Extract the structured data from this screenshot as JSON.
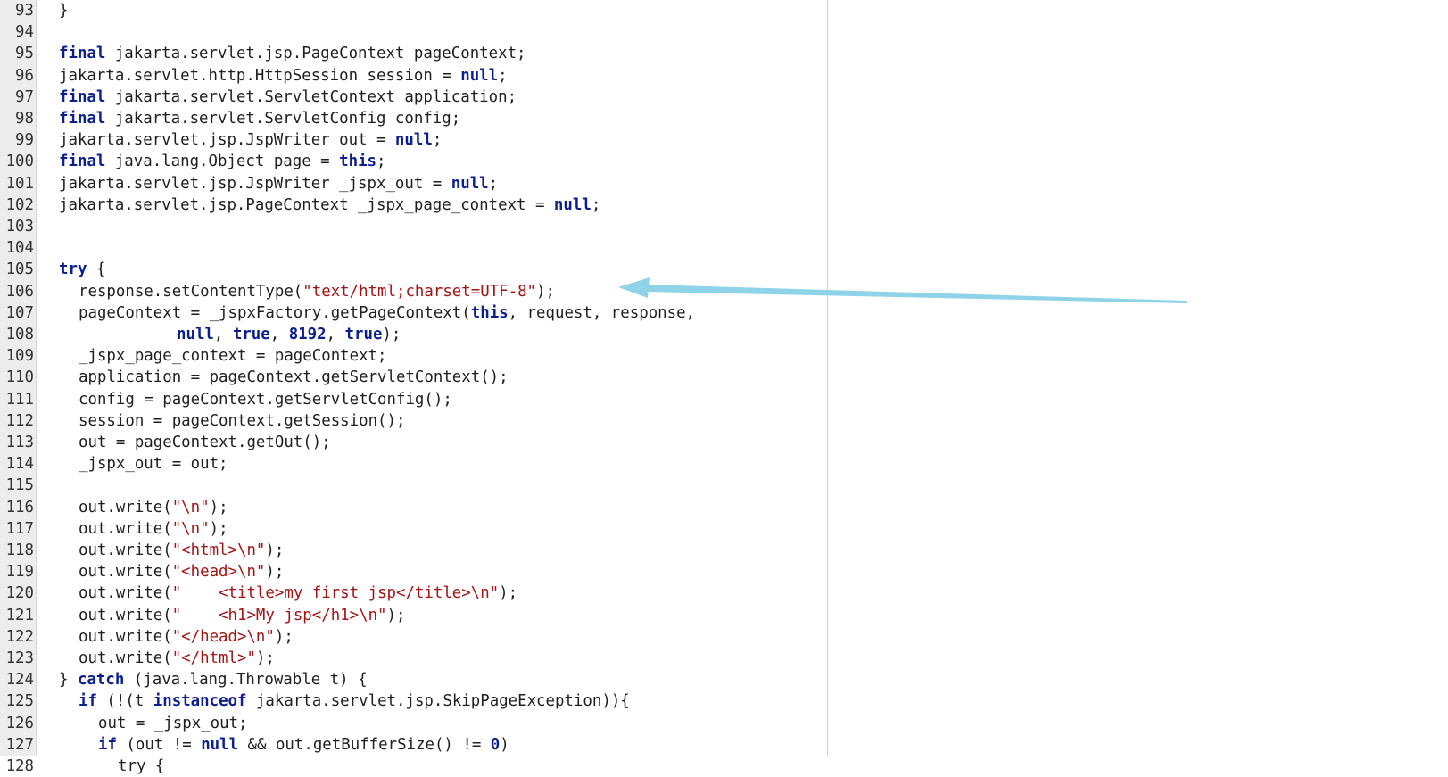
{
  "editor": {
    "lines": [
      {
        "n": "93",
        "indent": 1,
        "tokens": [
          {
            "t": "}",
            "k": "plain"
          }
        ]
      },
      {
        "n": "94",
        "indent": 0,
        "tokens": []
      },
      {
        "n": "95",
        "indent": 1,
        "tokens": [
          {
            "t": "final",
            "k": "kw"
          },
          {
            "t": " jakarta.servlet.jsp.PageContext pageContext;",
            "k": "plain"
          }
        ]
      },
      {
        "n": "96",
        "indent": 1,
        "tokens": [
          {
            "t": "jakarta.servlet.http.HttpSession session = ",
            "k": "plain"
          },
          {
            "t": "null",
            "k": "kw"
          },
          {
            "t": ";",
            "k": "plain"
          }
        ]
      },
      {
        "n": "97",
        "indent": 1,
        "tokens": [
          {
            "t": "final",
            "k": "kw"
          },
          {
            "t": " jakarta.servlet.ServletContext application;",
            "k": "plain"
          }
        ]
      },
      {
        "n": "98",
        "indent": 1,
        "tokens": [
          {
            "t": "final",
            "k": "kw"
          },
          {
            "t": " jakarta.servlet.ServletConfig config;",
            "k": "plain"
          }
        ]
      },
      {
        "n": "99",
        "indent": 1,
        "tokens": [
          {
            "t": "jakarta.servlet.jsp.JspWriter out = ",
            "k": "plain"
          },
          {
            "t": "null",
            "k": "kw"
          },
          {
            "t": ";",
            "k": "plain"
          }
        ]
      },
      {
        "n": "100",
        "indent": 1,
        "tokens": [
          {
            "t": "final",
            "k": "kw"
          },
          {
            "t": " java.lang.Object page = ",
            "k": "plain"
          },
          {
            "t": "this",
            "k": "kw"
          },
          {
            "t": ";",
            "k": "plain"
          }
        ]
      },
      {
        "n": "101",
        "indent": 1,
        "tokens": [
          {
            "t": "jakarta.servlet.jsp.JspWriter _jspx_out = ",
            "k": "plain"
          },
          {
            "t": "null",
            "k": "kw"
          },
          {
            "t": ";",
            "k": "plain"
          }
        ]
      },
      {
        "n": "102",
        "indent": 1,
        "tokens": [
          {
            "t": "jakarta.servlet.jsp.PageContext _jspx_page_context = ",
            "k": "plain"
          },
          {
            "t": "null",
            "k": "kw"
          },
          {
            "t": ";",
            "k": "plain"
          }
        ]
      },
      {
        "n": "103",
        "indent": 0,
        "tokens": []
      },
      {
        "n": "104",
        "indent": 0,
        "tokens": []
      },
      {
        "n": "105",
        "indent": 1,
        "tokens": [
          {
            "t": "try",
            "k": "kw"
          },
          {
            "t": " {",
            "k": "plain"
          }
        ]
      },
      {
        "n": "106",
        "indent": 2,
        "tokens": [
          {
            "t": "response.setContentType(",
            "k": "plain"
          },
          {
            "t": "\"text/html;charset=UTF-8\"",
            "k": "str"
          },
          {
            "t": ");",
            "k": "plain"
          }
        ]
      },
      {
        "n": "107",
        "indent": 2,
        "tokens": [
          {
            "t": "pageContext = _jspxFactory.getPageContext(",
            "k": "plain"
          },
          {
            "t": "this",
            "k": "kw"
          },
          {
            "t": ", request, response,",
            "k": "plain"
          }
        ]
      },
      {
        "n": "108",
        "indent": 7,
        "tokens": [
          {
            "t": "null",
            "k": "kw"
          },
          {
            "t": ", ",
            "k": "plain"
          },
          {
            "t": "true",
            "k": "kw"
          },
          {
            "t": ", ",
            "k": "plain"
          },
          {
            "t": "8192",
            "k": "kw"
          },
          {
            "t": ", ",
            "k": "plain"
          },
          {
            "t": "true",
            "k": "kw"
          },
          {
            "t": ");",
            "k": "plain"
          }
        ]
      },
      {
        "n": "109",
        "indent": 2,
        "tokens": [
          {
            "t": "_jspx_page_context = pageContext;",
            "k": "plain"
          }
        ]
      },
      {
        "n": "110",
        "indent": 2,
        "tokens": [
          {
            "t": "application = pageContext.getServletContext();",
            "k": "plain"
          }
        ]
      },
      {
        "n": "111",
        "indent": 2,
        "tokens": [
          {
            "t": "config = pageContext.getServletConfig();",
            "k": "plain"
          }
        ]
      },
      {
        "n": "112",
        "indent": 2,
        "tokens": [
          {
            "t": "session = pageContext.getSession();",
            "k": "plain"
          }
        ]
      },
      {
        "n": "113",
        "indent": 2,
        "tokens": [
          {
            "t": "out = pageContext.getOut();",
            "k": "plain"
          }
        ]
      },
      {
        "n": "114",
        "indent": 2,
        "tokens": [
          {
            "t": "_jspx_out = out;",
            "k": "plain"
          }
        ]
      },
      {
        "n": "115",
        "indent": 0,
        "tokens": []
      },
      {
        "n": "116",
        "indent": 2,
        "tokens": [
          {
            "t": "out.write(",
            "k": "plain"
          },
          {
            "t": "\"\\n\"",
            "k": "str"
          },
          {
            "t": ");",
            "k": "plain"
          }
        ]
      },
      {
        "n": "117",
        "indent": 2,
        "tokens": [
          {
            "t": "out.write(",
            "k": "plain"
          },
          {
            "t": "\"\\n\"",
            "k": "str"
          },
          {
            "t": ");",
            "k": "plain"
          }
        ]
      },
      {
        "n": "118",
        "indent": 2,
        "tokens": [
          {
            "t": "out.write(",
            "k": "plain"
          },
          {
            "t": "\"<html>\\n\"",
            "k": "str"
          },
          {
            "t": ");",
            "k": "plain"
          }
        ]
      },
      {
        "n": "119",
        "indent": 2,
        "tokens": [
          {
            "t": "out.write(",
            "k": "plain"
          },
          {
            "t": "\"<head>\\n\"",
            "k": "str"
          },
          {
            "t": ");",
            "k": "plain"
          }
        ]
      },
      {
        "n": "120",
        "indent": 2,
        "tokens": [
          {
            "t": "out.write(",
            "k": "plain"
          },
          {
            "t": "\"    <title>my first jsp</title>\\n\"",
            "k": "str"
          },
          {
            "t": ");",
            "k": "plain"
          }
        ]
      },
      {
        "n": "121",
        "indent": 2,
        "tokens": [
          {
            "t": "out.write(",
            "k": "plain"
          },
          {
            "t": "\"    <h1>My jsp</h1>\\n\"",
            "k": "str"
          },
          {
            "t": ");",
            "k": "plain"
          }
        ]
      },
      {
        "n": "122",
        "indent": 2,
        "tokens": [
          {
            "t": "out.write(",
            "k": "plain"
          },
          {
            "t": "\"</head>\\n\"",
            "k": "str"
          },
          {
            "t": ");",
            "k": "plain"
          }
        ]
      },
      {
        "n": "123",
        "indent": 2,
        "tokens": [
          {
            "t": "out.write(",
            "k": "plain"
          },
          {
            "t": "\"</html>\"",
            "k": "str"
          },
          {
            "t": ");",
            "k": "plain"
          }
        ]
      },
      {
        "n": "124",
        "indent": 1,
        "tokens": [
          {
            "t": "} ",
            "k": "plain"
          },
          {
            "t": "catch",
            "k": "kw"
          },
          {
            "t": " (java.lang.Throwable t) {",
            "k": "plain"
          }
        ]
      },
      {
        "n": "125",
        "indent": 2,
        "tokens": [
          {
            "t": "if",
            "k": "kw"
          },
          {
            "t": " (!(t ",
            "k": "plain"
          },
          {
            "t": "instanceof",
            "k": "kw"
          },
          {
            "t": " jakarta.servlet.jsp.SkipPageException)){",
            "k": "plain"
          }
        ]
      },
      {
        "n": "126",
        "indent": 3,
        "tokens": [
          {
            "t": "out = _jspx_out;",
            "k": "plain"
          }
        ]
      },
      {
        "n": "127",
        "indent": 3,
        "tokens": [
          {
            "t": "if",
            "k": "kw"
          },
          {
            "t": " (out != ",
            "k": "plain"
          },
          {
            "t": "null",
            "k": "kw"
          },
          {
            "t": " && out.getBufferSize() != ",
            "k": "plain"
          },
          {
            "t": "0",
            "k": "kw"
          },
          {
            "t": ")",
            "k": "plain"
          }
        ]
      },
      {
        "n": "128",
        "indent": 4,
        "tokens": [
          {
            "t": "try {",
            "k": "plain"
          }
        ]
      }
    ]
  },
  "annotation": {
    "arrow_color": "#8fd3e8",
    "arrow_name": "annotation-arrow"
  },
  "colors": {
    "keyword": "#0d1f8f",
    "string": "#a31515",
    "plain": "#1f1f1f",
    "gutter": "#ededed"
  }
}
